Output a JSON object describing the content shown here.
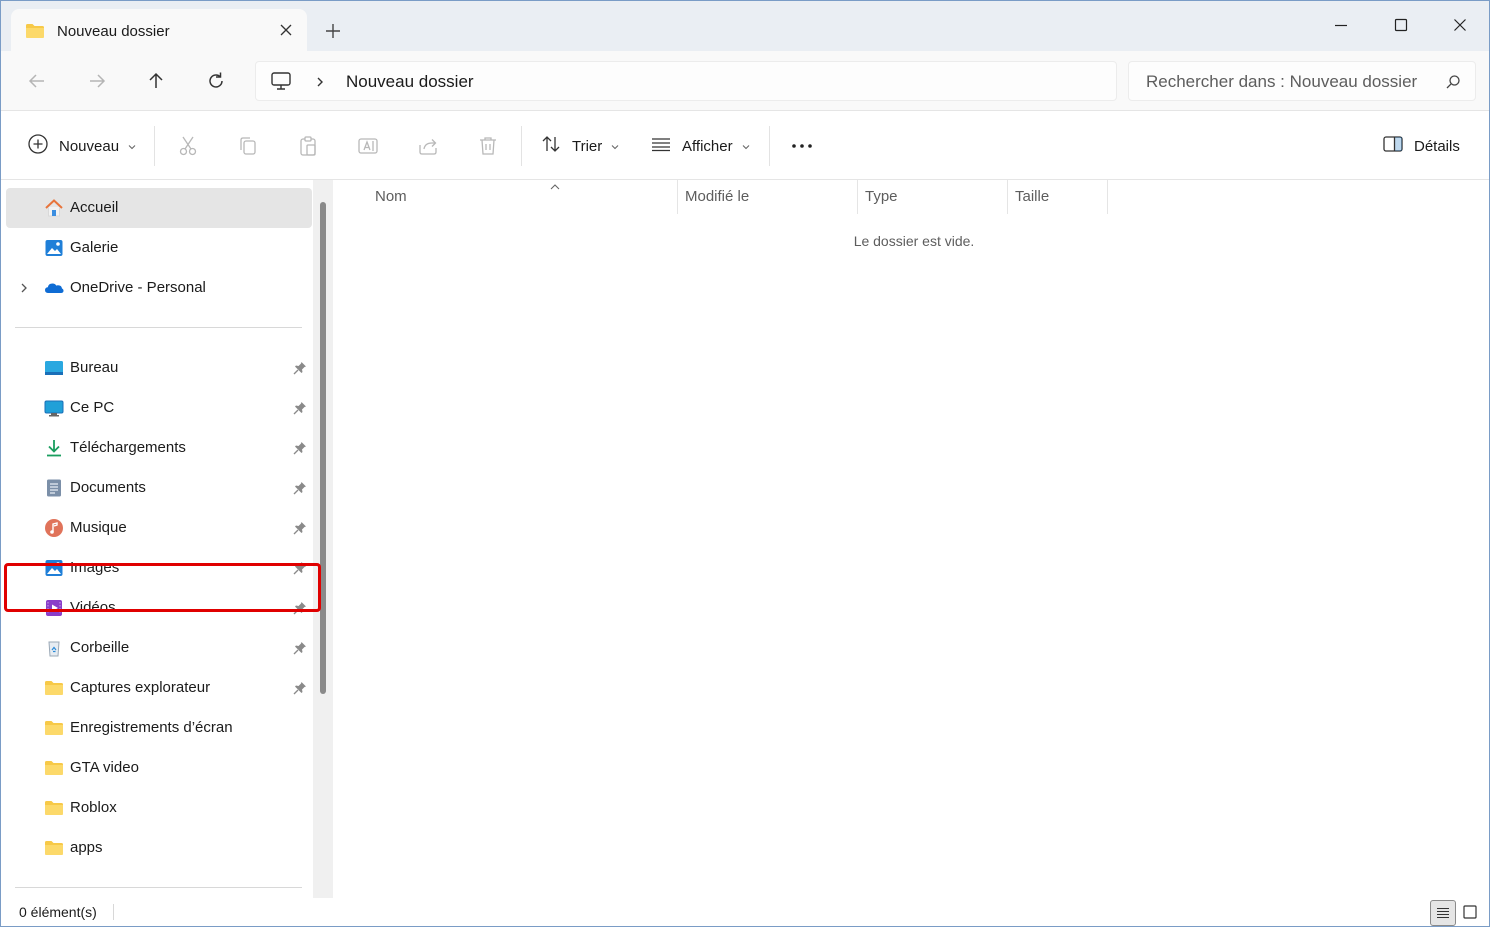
{
  "window": {
    "tab_title": "Nouveau dossier",
    "accent": "#0067c0",
    "highlight_color": "#e00000"
  },
  "address": {
    "location_icon": "this-pc-icon",
    "crumb": "Nouveau dossier",
    "search_placeholder": "Rechercher dans : Nouveau dossier"
  },
  "toolbar": {
    "new_label": "Nouveau",
    "sort_label": "Trier",
    "view_label": "Afficher",
    "details_label": "Détails",
    "disabled_icons": [
      "cut-icon",
      "copy-icon",
      "paste-icon",
      "rename-icon",
      "share-icon",
      "delete-icon"
    ]
  },
  "sidebar": {
    "top_items": [
      {
        "label": "Accueil",
        "icon": "home-icon",
        "selected": true
      },
      {
        "label": "Galerie",
        "icon": "gallery-icon"
      },
      {
        "label": "OneDrive - Personal",
        "icon": "onedrive-icon",
        "expandable": true
      }
    ],
    "pinned_items": [
      {
        "label": "Bureau",
        "icon": "desktop-icon",
        "pinned": true
      },
      {
        "label": "Ce PC",
        "icon": "this-pc-icon",
        "pinned": true,
        "highlighted": true
      },
      {
        "label": "Téléchargements",
        "icon": "download-icon",
        "pinned": true
      },
      {
        "label": "Documents",
        "icon": "documents-icon",
        "pinned": true
      },
      {
        "label": "Musique",
        "icon": "music-icon",
        "pinned": true
      },
      {
        "label": "Images",
        "icon": "pictures-icon",
        "pinned": true
      },
      {
        "label": "Vidéos",
        "icon": "videos-icon",
        "pinned": true
      },
      {
        "label": "Corbeille",
        "icon": "recycle-bin-icon",
        "pinned": true
      },
      {
        "label": "Captures explorateur",
        "icon": "folder-icon",
        "pinned": true
      },
      {
        "label": "Enregistrements d’écran",
        "icon": "folder-icon"
      },
      {
        "label": "GTA video",
        "icon": "folder-icon"
      },
      {
        "label": "Roblox",
        "icon": "folder-icon"
      },
      {
        "label": "apps",
        "icon": "folder-icon"
      }
    ]
  },
  "content": {
    "columns": [
      "Nom",
      "Modifié le",
      "Type",
      "Taille"
    ],
    "sorted_column": "Nom",
    "empty_message": "Le dossier est vide."
  },
  "status": {
    "count_text": "0 élément(s)",
    "view_mode": "details"
  }
}
